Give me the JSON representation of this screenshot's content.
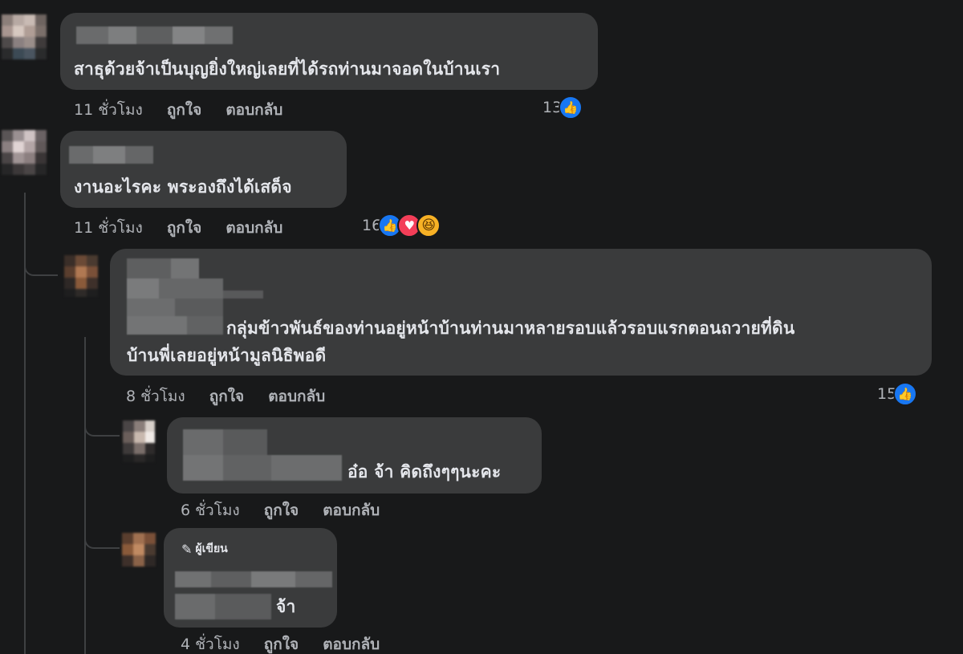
{
  "comments": [
    {
      "text": "สาธุด้วยจ้าเป็นบุญยิ่งใหญ่เลยที่ได้รถท่านมาจอดในบ้านเรา",
      "time": "11 ชั่วโมง",
      "like": "ถูกใจ",
      "reply": "ตอบกลับ",
      "reaction_count": "13",
      "reactions": [
        "like-icon"
      ]
    },
    {
      "text": "งานอะไรคะ พระองถึงได้เสด็จ",
      "time": "11 ชั่วโมง",
      "like": "ถูกใจ",
      "reply": "ตอบกลับ",
      "reaction_count": "16",
      "reactions": [
        "like-icon",
        "love-icon",
        "haha-icon"
      ]
    },
    {
      "text_line1": "กลุ่มข้าวพันธ์ของท่านอยู่หน้าบ้านท่านมาหลายรอบแล้วรอบแรกตอนถวายที่ดิน",
      "text_line2": "บ้านพี่เลยอยู่หน้ามูลนิธิพอดี",
      "time": "8 ชั่วโมง",
      "like": "ถูกใจ",
      "reply": "ตอบกลับ",
      "reaction_count": "15",
      "reactions": [
        "like-icon"
      ]
    },
    {
      "text": "อ๋อ จ้า คิดถึงๆๆนะคะ",
      "time": "6 ชั่วโมง",
      "like": "ถูกใจ",
      "reply": "ตอบกลับ"
    },
    {
      "badge": "ผู้เขียน",
      "text": "จ้า",
      "time": "4 ชั่วโมง",
      "like": "ถูกใจ",
      "reply": "ตอบกลับ"
    }
  ],
  "icons": {
    "like": "👍",
    "love": "♥",
    "haha": "😆",
    "pen": "✎"
  },
  "colors": {
    "background": "#18191a",
    "bubble": "#3a3b3c",
    "text": "#e4e6eb",
    "secondary_text": "#b0b3b8",
    "like_blue": "#1877f2",
    "love_red": "#f33e58",
    "haha_yellow": "#f7b125"
  }
}
